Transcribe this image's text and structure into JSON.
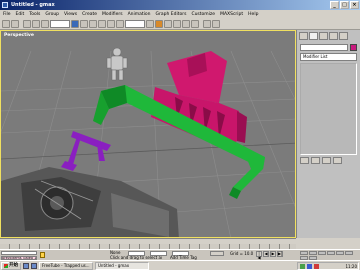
{
  "window": {
    "title": "Untitled - gmax",
    "controls": [
      "_",
      "□",
      "×"
    ]
  },
  "menu": [
    "File",
    "Edit",
    "Tools",
    "Group",
    "Views",
    "Create",
    "Modifiers",
    "Animation",
    "Graph Editors",
    "Customize",
    "MAXScript",
    "Help"
  ],
  "viewport": {
    "label": "Perspective"
  },
  "command_panel": {
    "modifier_list": "Modifier List",
    "object_color": "#c8197e"
  },
  "status": {
    "selection": "None",
    "prompt": "Click and drag to select ai",
    "time_tag": "Add Time Tag",
    "grid": "Grid = 10.0",
    "listener_text": "prevxitems_paleo 1"
  },
  "playback": [
    "|◀",
    "◀",
    "▶",
    "▶|"
  ],
  "taskbar": {
    "start_label": "开始",
    "items": [
      {
        "label": "FreeTube - Trapped us...",
        "active": false
      },
      {
        "label": "Untitled - gmax",
        "active": true
      }
    ],
    "clock": "11:20"
  }
}
